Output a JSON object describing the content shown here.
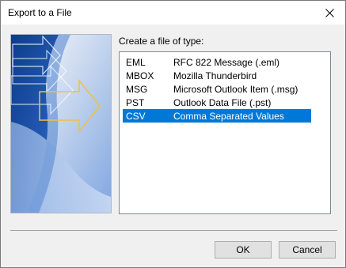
{
  "window": {
    "title": "Export to a File"
  },
  "main": {
    "type_label": "Create a file of type:",
    "file_types": [
      {
        "abbr": "EML",
        "description": "RFC 822 Message (.eml)",
        "selected": false
      },
      {
        "abbr": "MBOX",
        "description": "Mozilla Thunderbird",
        "selected": false
      },
      {
        "abbr": "MSG",
        "description": "Microsoft Outlook Item (.msg)",
        "selected": false
      },
      {
        "abbr": "PST",
        "description": "Outlook Data File (.pst)",
        "selected": false
      },
      {
        "abbr": "CSV",
        "description": "Comma Separated Values",
        "selected": true
      }
    ]
  },
  "buttons": {
    "ok_label": "OK",
    "cancel_label": "Cancel"
  },
  "icons": {
    "close": "close-icon",
    "wizard": "export-arrow-illustration"
  },
  "colors": {
    "selection": "#0078d7",
    "illustration_blue": "#1e4fa0",
    "arrow_outline": "#f0c040"
  }
}
